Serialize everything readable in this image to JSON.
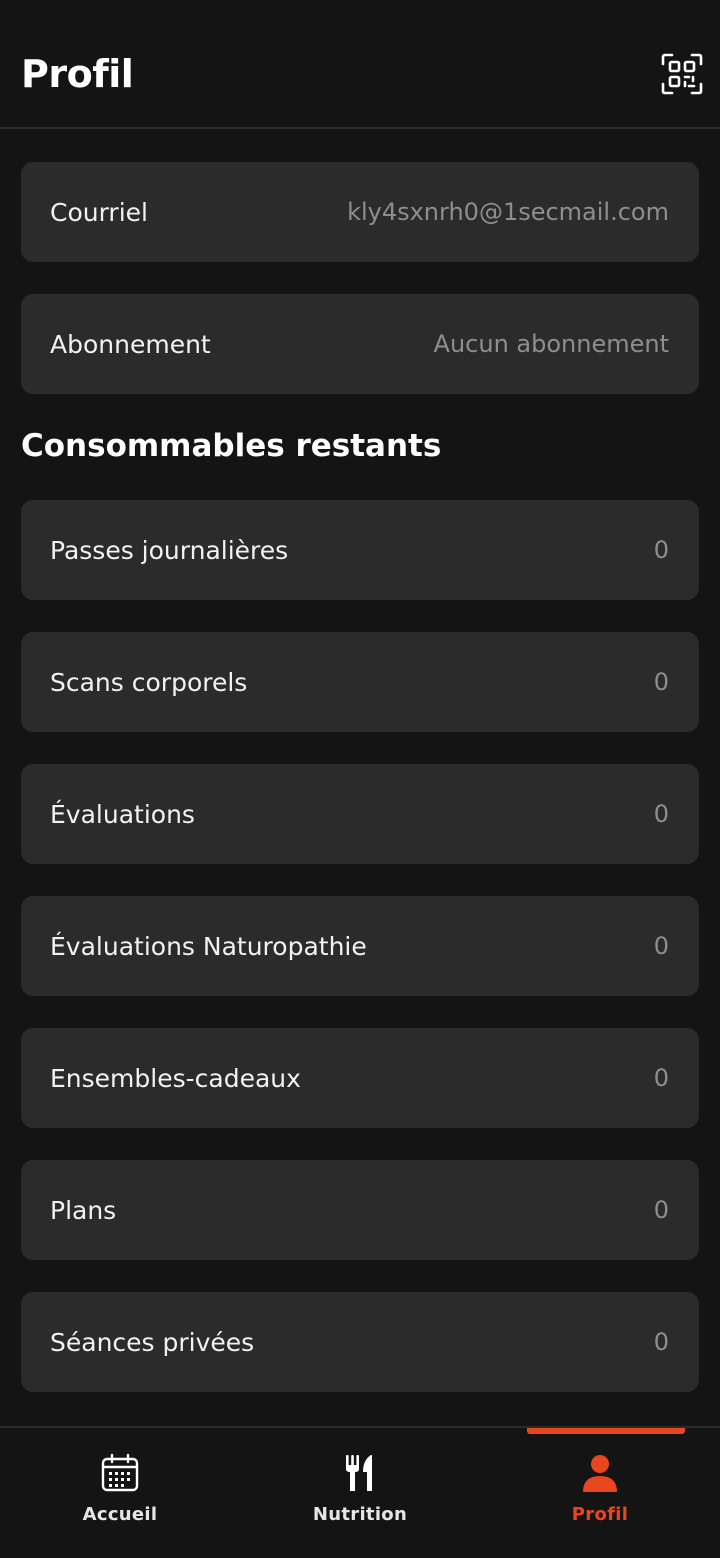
{
  "header": {
    "title": "Profil",
    "qr_icon": "qr-code-icon"
  },
  "account": [
    {
      "label": "Courriel",
      "value": "kly4sxnrh0@1secmail.com"
    },
    {
      "label": "Abonnement",
      "value": "Aucun abonnement"
    }
  ],
  "consumables": {
    "title": "Consommables restants",
    "items": [
      {
        "label": "Passes journalières",
        "value": "0"
      },
      {
        "label": "Scans corporels",
        "value": "0"
      },
      {
        "label": "Évaluations",
        "value": "0"
      },
      {
        "label": "Évaluations Naturopathie",
        "value": "0"
      },
      {
        "label": "Ensembles-cadeaux",
        "value": "0"
      },
      {
        "label": "Plans",
        "value": "0"
      },
      {
        "label": "Séances privées",
        "value": "0"
      }
    ]
  },
  "nav": {
    "items": [
      {
        "label": "Accueil",
        "icon": "calendar-icon"
      },
      {
        "label": "Nutrition",
        "icon": "fork-knife-icon"
      },
      {
        "label": "Profil",
        "icon": "person-icon"
      }
    ],
    "active": "Profil"
  },
  "colors": {
    "background": "#141414",
    "card": "#2b2b2b",
    "accent": "#e8461e",
    "muted_text": "#8e8e8e"
  }
}
